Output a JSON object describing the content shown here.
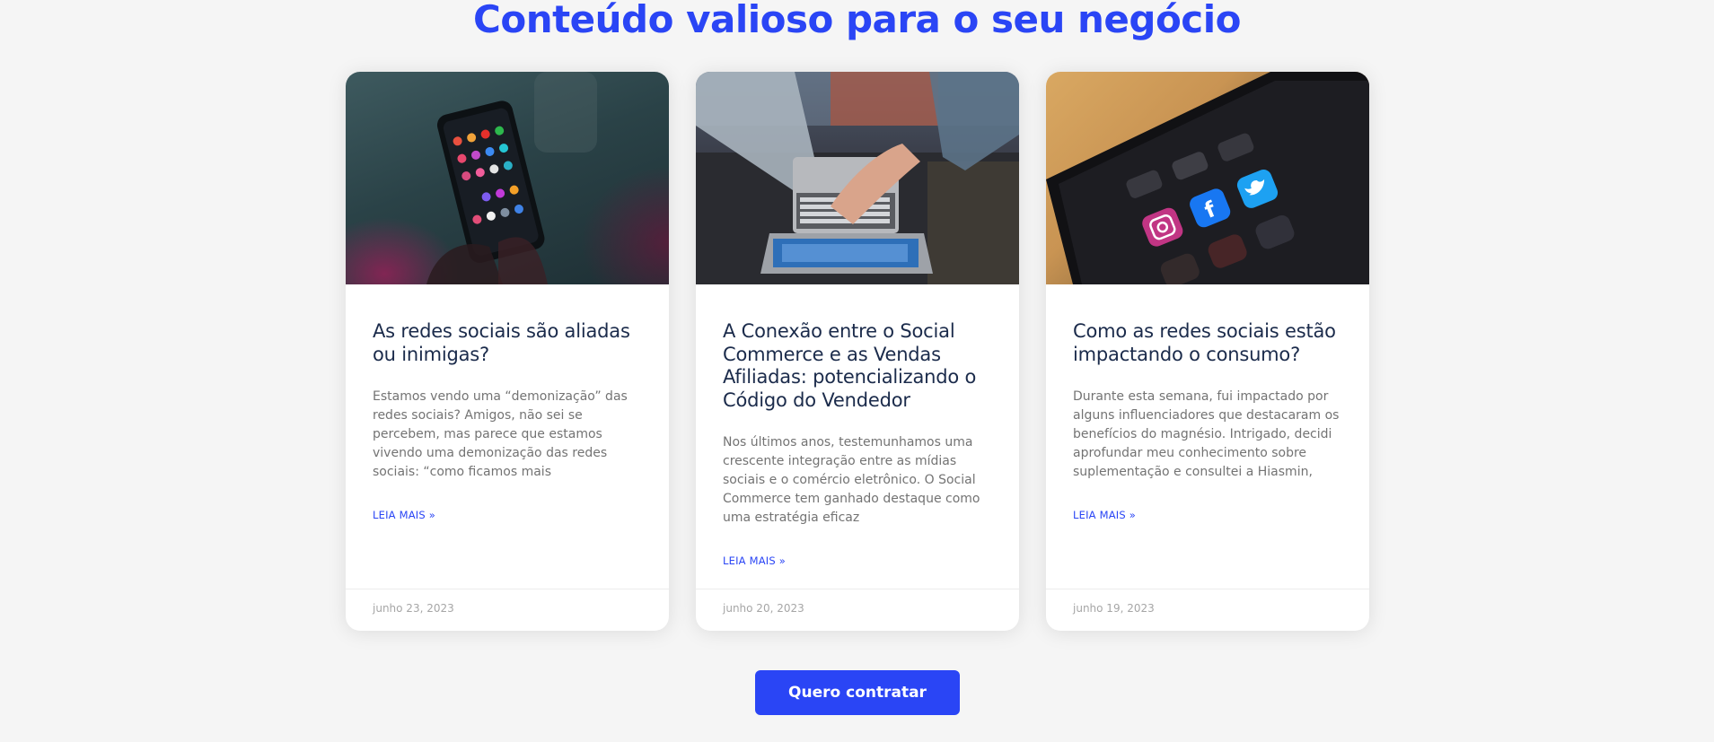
{
  "section": {
    "title": "Conteúdo valioso para o seu negócio"
  },
  "cards": [
    {
      "title": "As redes sociais são aliadas ou inimigas?",
      "excerpt": "Estamos vendo uma “demonização” das redes sociais? Amigos, não sei se percebem, mas parece que estamos vivendo uma demonização das redes sociais: “como ficamos mais",
      "read_more": "LEIA MAIS »",
      "date": "junho 23, 2023",
      "image_icon": "phone-in-hand-photo"
    },
    {
      "title": "A Conexão entre o Social Commerce e as Vendas Afiliadas: potencializando o Código do Vendedor",
      "excerpt": "Nos últimos anos, testemunhamos uma crescente integração entre as mídias sociais e o comércio eletrônico. O Social Commerce tem ganhado destaque como uma estratégia eficaz",
      "read_more": "LEIA MAIS »",
      "date": "junho 20, 2023",
      "image_icon": "laptop-team-photo"
    },
    {
      "title": "Como as redes sociais estão impactando o consumo?",
      "excerpt": "Durante esta semana, fui impactado por alguns influenciadores que destacaram os benefícios do magnésio. Intrigado, decidi aprofundar meu conhecimento sobre suplementação e consultei a Hiasmin,",
      "read_more": "LEIA MAIS »",
      "date": "junho 19, 2023",
      "image_icon": "phone-social-apps-photo"
    }
  ],
  "cta": {
    "label": "Quero contratar"
  },
  "colors": {
    "accent": "#2a45f5",
    "title_text": "#1b2b4b",
    "body_text": "#737373",
    "meta_text": "#a6a6a6",
    "page_bg": "#f5f5f5"
  }
}
